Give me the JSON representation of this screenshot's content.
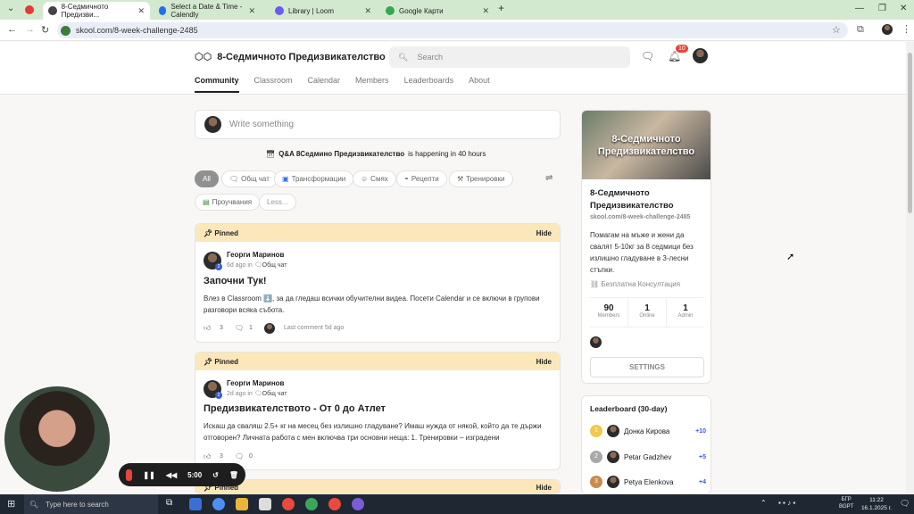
{
  "browser": {
    "tabs": [
      {
        "label": "8-Седмичното Предизви..."
      },
      {
        "label": "Select a Date & Time - Calendly"
      },
      {
        "label": "Library | Loom"
      },
      {
        "label": "Google Карти"
      }
    ],
    "url": "skool.com/8-week-challenge-2485"
  },
  "header": {
    "title": "8-Седмичното Предизвикателство",
    "search_placeholder": "Search",
    "notif_count": "10",
    "tabs": [
      "Community",
      "Classroom",
      "Calendar",
      "Members",
      "Leaderboards",
      "About"
    ]
  },
  "composer": {
    "placeholder": "Write something"
  },
  "event": {
    "bold": "Q&A 8Седмино Предизвикателство",
    "rest": " is happening in 40 hours"
  },
  "filters": [
    "All",
    "Общ чат",
    "Трансформации",
    "Смях",
    "Рецепти",
    "Тренировки",
    "Проучвания",
    "Less..."
  ],
  "posts": [
    {
      "pin": "Pinned",
      "hide": "Hide",
      "author": "Георги Маринов",
      "level": "2",
      "meta": "6d ago in",
      "category": "Общ чат",
      "title": "Започни Тук!",
      "body": "Влез в Classroom ⬇️, за да гледаш всички обучителни видеа. Посети Calendar и се включи в групови разговори всяка събота.",
      "likes": "3",
      "comments": "1",
      "last": "Last comment 5d ago"
    },
    {
      "pin": "Pinned",
      "hide": "Hide",
      "author": "Георги Маринов",
      "level": "2",
      "meta": "2d ago in",
      "category": "Общ чат",
      "title": "Предизвикателството - От 0 до Атлет",
      "body": "Искаш да сваляш 2.5+ кг на месец без излишно гладуване? Имаш нужда от някой, който да те държи отговорен? Личната работа с мен включва три основни неща: 1. Тренировки – изградени",
      "likes": "3",
      "comments": "0"
    },
    {
      "pin": "Pinned",
      "hide": "Hide"
    }
  ],
  "about": {
    "banner": "8-Седмичното Предизвикателство",
    "name": "8-Седмичното Предизвикателство",
    "url": "skool.com/8-week-challenge-2485",
    "desc": "Помагам на мъже и жени да свалят 5-10кг за 8 седмици без излишно гладуване в 3-лесни стъпки.",
    "link": "Безплатна Консултация",
    "stats": [
      {
        "value": "90",
        "label": "Members"
      },
      {
        "value": "1",
        "label": "Online"
      },
      {
        "value": "1",
        "label": "Admin"
      }
    ],
    "settings": "SETTINGS"
  },
  "leaderboard": {
    "title": "Leaderboard (30-day)",
    "rows": [
      {
        "rank": "1",
        "name": "Донка Кирова",
        "points": "+10"
      },
      {
        "rank": "2",
        "name": "Petar Gadzhev",
        "points": "+5"
      },
      {
        "rank": "3",
        "name": "Petya Elenkova",
        "points": "+4"
      }
    ]
  },
  "recorder": {
    "time": "5:00"
  },
  "taskbar": {
    "search": "Type here to search",
    "lang": "БГР",
    "lang2": "BGPT",
    "time": "11:22",
    "date": "16.1.2025 г."
  },
  "colors": {
    "pinned": "#fbe7b9",
    "tabstrip": "#d3e9cf",
    "accent": "#202124",
    "link": "#3b5bdb"
  }
}
